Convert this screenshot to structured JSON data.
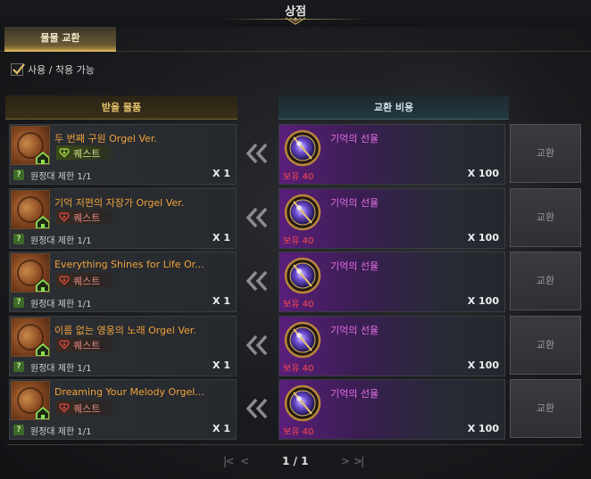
{
  "window": {
    "title": "상점"
  },
  "tabs": [
    {
      "label": "물물 교환",
      "active": true
    }
  ],
  "filter": {
    "label": "사용 / 착용 가능",
    "checked": true
  },
  "columns": {
    "reward": "받을 물품",
    "cost": "교환 비용"
  },
  "rows": [
    {
      "name": "두 번째 구원 Orgel Ver.",
      "quest_label": "퀘스트",
      "quest_style": "green",
      "limit": "원정대 제한 1/1",
      "reward_qty": "X 1",
      "cost_name": "기억의 선율",
      "owned": "보유 40",
      "cost_qty": "X 100",
      "button": "교환"
    },
    {
      "name": "기억 저편의 자장가 Orgel Ver.",
      "quest_label": "퀘스트",
      "quest_style": "red",
      "limit": "원정대 제한 1/1",
      "reward_qty": "X 1",
      "cost_name": "기억의 선율",
      "owned": "보유 40",
      "cost_qty": "X 100",
      "button": "교환"
    },
    {
      "name": "Everything Shines for Life Or...",
      "quest_label": "퀘스트",
      "quest_style": "red",
      "limit": "원정대 제한 1/1",
      "reward_qty": "X 1",
      "cost_name": "기억의 선율",
      "owned": "보유 40",
      "cost_qty": "X 100",
      "button": "교환"
    },
    {
      "name": "이름 없는 영웅의 노래 Orgel Ver.",
      "quest_label": "퀘스트",
      "quest_style": "red",
      "limit": "원정대 제한 1/1",
      "reward_qty": "X 1",
      "cost_name": "기억의 선율",
      "owned": "보유 40",
      "cost_qty": "X 100",
      "button": "교환"
    },
    {
      "name": "Dreaming Your Melody Orgel...",
      "quest_label": "퀘스트",
      "quest_style": "red",
      "limit": "원정대 제한 1/1",
      "reward_qty": "X 1",
      "cost_name": "기억의 선율",
      "owned": "보유 40",
      "cost_qty": "X 100",
      "button": "교환"
    }
  ],
  "pager": {
    "first": "|<",
    "prev": "<",
    "text": "1 / 1",
    "next": ">",
    "last": ">|"
  },
  "icons": {
    "reward": "music-sheet-icon",
    "house": "house-icon",
    "heart": "heart-quest-icon",
    "help": "question-icon",
    "arrows": "double-chevron-left-icon",
    "cost": "melody-orb-icon"
  },
  "colors": {
    "accent_gold": "#d9b45a",
    "item_orange": "#f2a23c",
    "cost_purple": "#e36ee6",
    "owned_red": "#ff4a4a"
  }
}
